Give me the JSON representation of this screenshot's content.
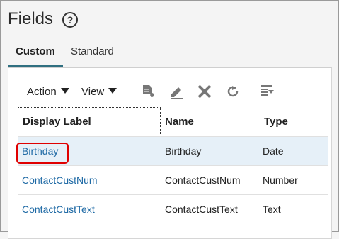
{
  "page": {
    "title": "Fields"
  },
  "tabs": [
    {
      "label": "Custom",
      "active": true
    },
    {
      "label": "Standard",
      "active": false
    }
  ],
  "toolbar": {
    "action_label": "Action",
    "view_label": "View",
    "icons": [
      "create-icon",
      "edit-icon",
      "delete-icon",
      "refresh-icon",
      "freeze-icon"
    ]
  },
  "table": {
    "headers": [
      "Display Label",
      "Name",
      "Type"
    ],
    "rows": [
      {
        "label": "Birthday",
        "name": "Birthday",
        "type": "Date",
        "selected": true
      },
      {
        "label": "ContactCustNum",
        "name": "ContactCustNum",
        "type": "Number",
        "selected": false
      },
      {
        "label": "ContactCustText",
        "name": "ContactCustText",
        "type": "Text",
        "selected": false
      }
    ]
  },
  "colors": {
    "accent": "#2f6f80",
    "link": "#1f6aa5",
    "highlight": "#e00000",
    "selected_row": "#e6f0f8"
  }
}
